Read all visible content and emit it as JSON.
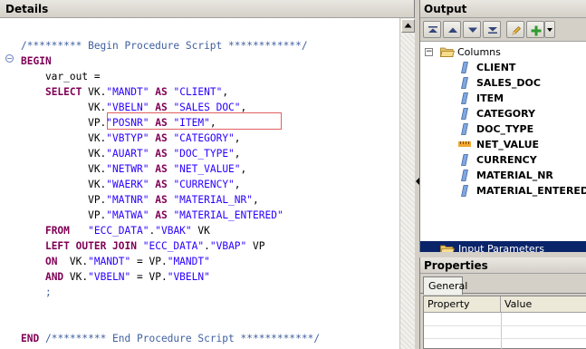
{
  "details": {
    "title": "Details",
    "code_lines": [
      {
        "parts": [
          {
            "t": "/********* Begin Procedure Script ************/",
            "c": "cm"
          }
        ]
      },
      {
        "parts": [
          {
            "t": "BEGIN",
            "c": "kw"
          }
        ]
      },
      {
        "parts": [
          {
            "t": "    var_out =",
            "c": "pl"
          }
        ]
      },
      {
        "parts": [
          {
            "t": "    ",
            "c": "pl"
          },
          {
            "t": "SELECT",
            "c": "kw"
          },
          {
            "t": " VK.",
            "c": "pl"
          },
          {
            "t": "\"MANDT\"",
            "c": "st"
          },
          {
            "t": " ",
            "c": "pl"
          },
          {
            "t": "AS",
            "c": "kw"
          },
          {
            "t": " ",
            "c": "pl"
          },
          {
            "t": "\"CLIENT\"",
            "c": "st"
          },
          {
            "t": ",",
            "c": "pl"
          }
        ]
      },
      {
        "parts": [
          {
            "t": "           VK.",
            "c": "pl"
          },
          {
            "t": "\"VBELN\"",
            "c": "st"
          },
          {
            "t": " ",
            "c": "pl"
          },
          {
            "t": "AS",
            "c": "kw"
          },
          {
            "t": " ",
            "c": "pl"
          },
          {
            "t": "\"SALES DOC\"",
            "c": "st"
          },
          {
            "t": ",",
            "c": "pl"
          }
        ]
      },
      {
        "parts": [
          {
            "t": "           VP.",
            "c": "pl"
          },
          {
            "t": "\"POSNR\"",
            "c": "st"
          },
          {
            "t": " ",
            "c": "pl"
          },
          {
            "t": "AS",
            "c": "kw"
          },
          {
            "t": " ",
            "c": "pl"
          },
          {
            "t": "\"ITEM\"",
            "c": "st"
          },
          {
            "t": ",",
            "c": "pl"
          }
        ]
      },
      {
        "parts": [
          {
            "t": "           VK.",
            "c": "pl"
          },
          {
            "t": "\"VBTYP\"",
            "c": "st"
          },
          {
            "t": " ",
            "c": "pl"
          },
          {
            "t": "AS",
            "c": "kw"
          },
          {
            "t": " ",
            "c": "pl"
          },
          {
            "t": "\"CATEGORY\"",
            "c": "st"
          },
          {
            "t": ",",
            "c": "pl"
          }
        ]
      },
      {
        "parts": [
          {
            "t": "           VK.",
            "c": "pl"
          },
          {
            "t": "\"AUART\"",
            "c": "st"
          },
          {
            "t": " ",
            "c": "pl"
          },
          {
            "t": "AS",
            "c": "kw"
          },
          {
            "t": " ",
            "c": "pl"
          },
          {
            "t": "\"DOC_TYPE\"",
            "c": "st"
          },
          {
            "t": ",",
            "c": "pl"
          }
        ]
      },
      {
        "parts": [
          {
            "t": "           VK.",
            "c": "pl"
          },
          {
            "t": "\"NETWR\"",
            "c": "st"
          },
          {
            "t": " ",
            "c": "pl"
          },
          {
            "t": "AS",
            "c": "kw"
          },
          {
            "t": " ",
            "c": "pl"
          },
          {
            "t": "\"NET_VALUE\"",
            "c": "st"
          },
          {
            "t": ",",
            "c": "pl"
          }
        ]
      },
      {
        "parts": [
          {
            "t": "           VK.",
            "c": "pl"
          },
          {
            "t": "\"WAERK\"",
            "c": "st"
          },
          {
            "t": " ",
            "c": "pl"
          },
          {
            "t": "AS",
            "c": "kw"
          },
          {
            "t": " ",
            "c": "pl"
          },
          {
            "t": "\"CURRENCY\"",
            "c": "st"
          },
          {
            "t": ",",
            "c": "pl"
          }
        ]
      },
      {
        "parts": [
          {
            "t": "           VP.",
            "c": "pl"
          },
          {
            "t": "\"MATNR\"",
            "c": "st"
          },
          {
            "t": " ",
            "c": "pl"
          },
          {
            "t": "AS",
            "c": "kw"
          },
          {
            "t": " ",
            "c": "pl"
          },
          {
            "t": "\"MATERIAL_NR\"",
            "c": "st"
          },
          {
            "t": ",",
            "c": "pl"
          }
        ]
      },
      {
        "parts": [
          {
            "t": "           VP.",
            "c": "pl"
          },
          {
            "t": "\"MATWA\"",
            "c": "st"
          },
          {
            "t": " ",
            "c": "pl"
          },
          {
            "t": "AS",
            "c": "kw"
          },
          {
            "t": " ",
            "c": "pl"
          },
          {
            "t": "\"MATERIAL_ENTERED\"",
            "c": "st"
          }
        ]
      },
      {
        "parts": [
          {
            "t": "    ",
            "c": "pl"
          },
          {
            "t": "FROM",
            "c": "kw"
          },
          {
            "t": "   ",
            "c": "pl"
          },
          {
            "t": "\"ECC_DATA\"",
            "c": "st"
          },
          {
            "t": ".",
            "c": "pl"
          },
          {
            "t": "\"VBAK\"",
            "c": "st"
          },
          {
            "t": " VK",
            "c": "pl"
          }
        ]
      },
      {
        "parts": [
          {
            "t": "    ",
            "c": "pl"
          },
          {
            "t": "LEFT OUTER JOIN",
            "c": "kw"
          },
          {
            "t": " ",
            "c": "pl"
          },
          {
            "t": "\"ECC_DATA\"",
            "c": "st"
          },
          {
            "t": ".",
            "c": "pl"
          },
          {
            "t": "\"VBAP\"",
            "c": "st"
          },
          {
            "t": " VP",
            "c": "pl"
          }
        ]
      },
      {
        "parts": [
          {
            "t": "    ",
            "c": "pl"
          },
          {
            "t": "ON",
            "c": "kw"
          },
          {
            "t": "  VK.",
            "c": "pl"
          },
          {
            "t": "\"MANDT\"",
            "c": "st"
          },
          {
            "t": " = VP.",
            "c": "pl"
          },
          {
            "t": "\"MANDT\"",
            "c": "st"
          }
        ]
      },
      {
        "parts": [
          {
            "t": "    ",
            "c": "pl"
          },
          {
            "t": "AND",
            "c": "kw"
          },
          {
            "t": " VK.",
            "c": "pl"
          },
          {
            "t": "\"VBELN\"",
            "c": "st"
          },
          {
            "t": " = VP.",
            "c": "pl"
          },
          {
            "t": "\"VBELN\"",
            "c": "st"
          }
        ]
      },
      {
        "parts": [
          {
            "t": "    ",
            "c": "pl"
          },
          {
            "t": ";",
            "c": "cm"
          }
        ]
      },
      {
        "parts": [
          {
            "t": "",
            "c": "pl"
          }
        ]
      },
      {
        "parts": [
          {
            "t": "",
            "c": "pl"
          }
        ]
      },
      {
        "parts": [
          {
            "t": "END",
            "c": "kw"
          },
          {
            "t": " ",
            "c": "pl"
          },
          {
            "t": "/********* End Procedure Script ************/",
            "c": "cm"
          }
        ]
      }
    ]
  },
  "output": {
    "title": "Output",
    "toolbar": [
      "move-top-icon",
      "move-up-icon",
      "move-down-icon",
      "move-bottom-icon",
      "edit-pencil-icon",
      "add-plus-icon",
      "dropdown-arrow-icon"
    ],
    "tree": {
      "columns_label": "Columns",
      "columns": [
        {
          "label": "CLIENT",
          "icon": "text-column-icon"
        },
        {
          "label": "SALES_DOC",
          "icon": "text-column-icon"
        },
        {
          "label": "ITEM",
          "icon": "text-column-icon"
        },
        {
          "label": "CATEGORY",
          "icon": "text-column-icon"
        },
        {
          "label": "DOC_TYPE",
          "icon": "text-column-icon"
        },
        {
          "label": "NET_VALUE",
          "icon": "measure-column-icon"
        },
        {
          "label": "CURRENCY",
          "icon": "text-column-icon"
        },
        {
          "label": "MATERIAL_NR",
          "icon": "text-column-icon"
        },
        {
          "label": "MATERIAL_ENTERED",
          "icon": "text-column-icon"
        }
      ],
      "input_params_label": "Input Parameters"
    }
  },
  "properties": {
    "title": "Properties",
    "tab": "General",
    "headers": [
      "Property",
      "Value"
    ]
  },
  "colors": {
    "keyword": "#7f0055",
    "string": "#2a00ff",
    "comment": "#3f5f9f",
    "selection": "#0a246a",
    "highlight_border": "#e06060"
  }
}
